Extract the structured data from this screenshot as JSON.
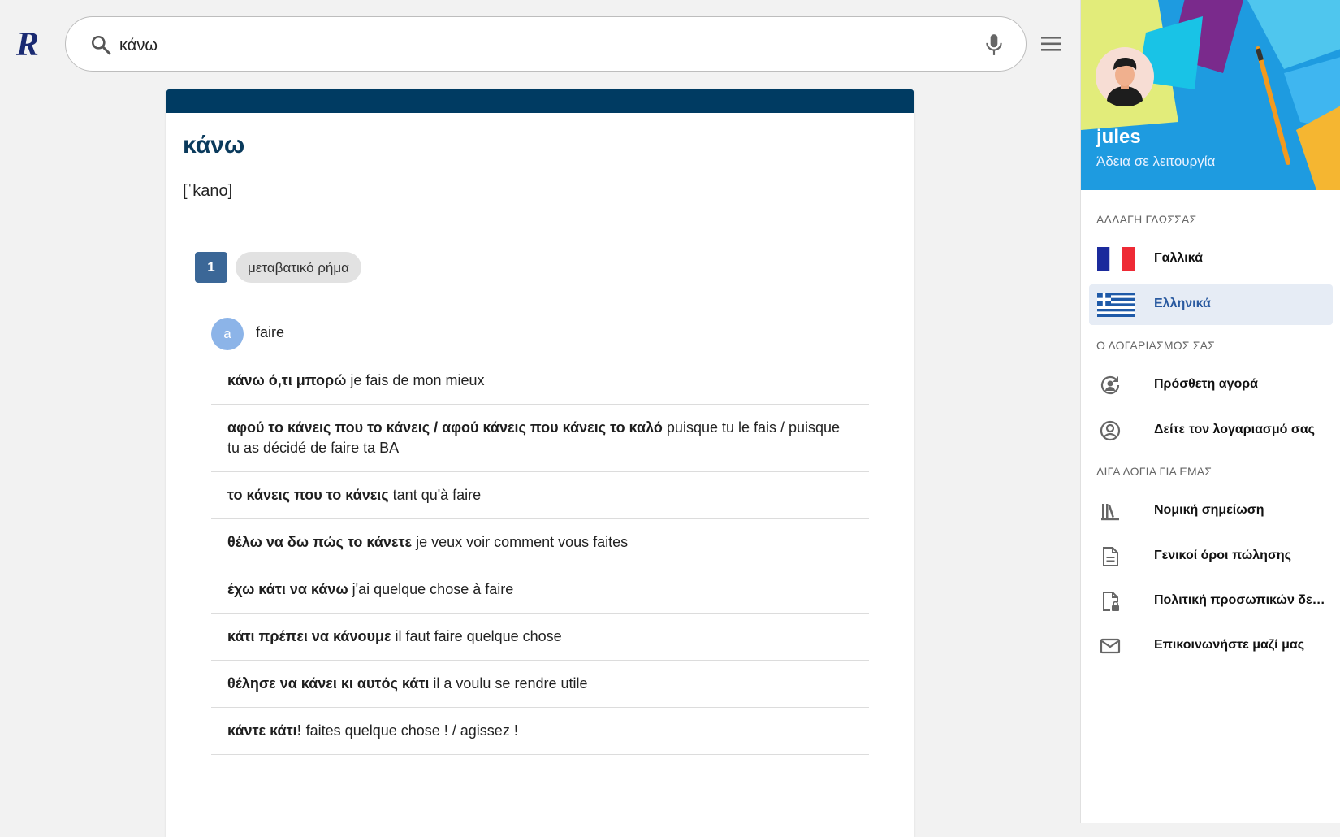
{
  "search": {
    "value": "κάνω"
  },
  "entry": {
    "headword": "κάνω",
    "phonetic": "[ˈkano]",
    "sense_number": "1",
    "part_of_speech": "μεταβατικό ρήμα",
    "sub_letter": "a",
    "sub_translation": "faire",
    "examples": [
      {
        "greek": "κάνω ό,τι μπορώ",
        "french": "je fais de mon mieux"
      },
      {
        "greek": "αφού το κάνεις που το κάνεις / αφού κάνεις που κάνεις το καλό",
        "french": "puisque tu le fais / puisque tu as décidé de faire ta BA"
      },
      {
        "greek": "το κάνεις που το κάνεις",
        "french": "tant qu'à faire"
      },
      {
        "greek": "θέλω να δω πώς το κάνετε",
        "french": "je veux voir comment vous faites"
      },
      {
        "greek": "έχω κάτι να κάνω",
        "french": "j'ai quelque chose à faire"
      },
      {
        "greek": "κάτι πρέπει να κάνουμε",
        "french": "il faut faire quelque chose"
      },
      {
        "greek": "θέλησε να κάνει κι αυτός κάτι",
        "french": "il a voulu se rendre utile"
      },
      {
        "greek": "κάντε κάτι!",
        "french": "faites quelque chose ! / agissez !"
      }
    ]
  },
  "sidebar": {
    "user_name": "jules",
    "user_status": "Άδεια σε λειτουργία",
    "language_title": "ΑΛΛΑΓΗ ΓΛΩΣΣΑΣ",
    "languages": [
      {
        "label": "Γαλλικά",
        "icon": "france-flag-icon"
      },
      {
        "label": "Ελληνικά",
        "icon": "greece-flag-icon",
        "active": true
      }
    ],
    "account_title": "Ο ΛΟΓΑΡΙΑΣΜΟΣ ΣΑΣ",
    "account_items": [
      {
        "label": "Πρόσθετη αγορά",
        "icon": "account-refresh-icon"
      },
      {
        "label": "Δείτε τον λογαριασμό σας",
        "icon": "account-circle-icon"
      }
    ],
    "about_title": "ΛΙΓΑ ΛΟΓΙΑ ΓΙΑ ΕΜΑΣ",
    "about_items": [
      {
        "label": "Νομική σημείωση",
        "icon": "library-icon"
      },
      {
        "label": "Γενικοί όροι πώλησης",
        "icon": "document-icon"
      },
      {
        "label": "Πολιτική προσωπικών δεδομένων",
        "icon": "file-lock-icon"
      },
      {
        "label": "Επικοινωνήστε μαζί μας",
        "icon": "mail-icon"
      }
    ]
  },
  "colors": {
    "header_bar": "#003b62",
    "headword": "#0a3a5c",
    "sense_badge": "#3b6797",
    "sub_badge": "#8cb4e8",
    "active_item_bg": "#e6ecf5"
  }
}
